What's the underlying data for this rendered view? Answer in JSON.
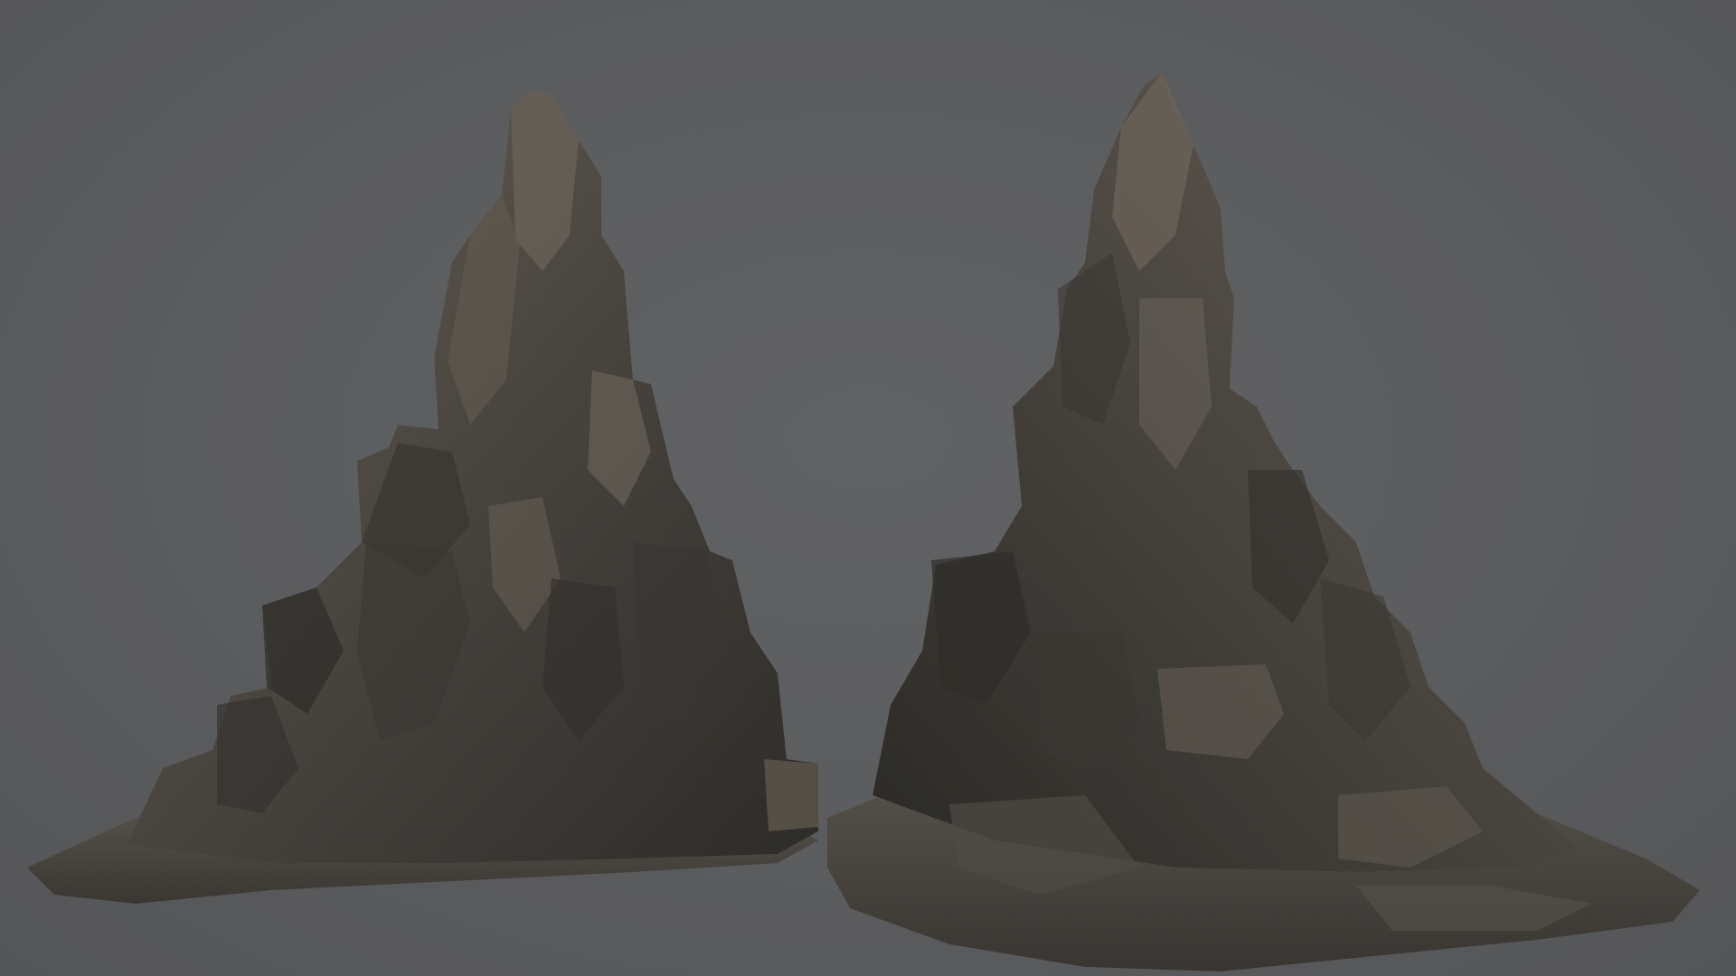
{
  "scene": {
    "background_color": "#5b5c5e",
    "rock_base_color": "#4a4640",
    "rock_dark_color": "#2e2c29",
    "rock_light_color": "#7a7268",
    "objects": [
      {
        "name": "rock-spire-left",
        "description_icon": "rock-icon"
      },
      {
        "name": "rock-spire-right",
        "description_icon": "rock-icon"
      }
    ]
  }
}
